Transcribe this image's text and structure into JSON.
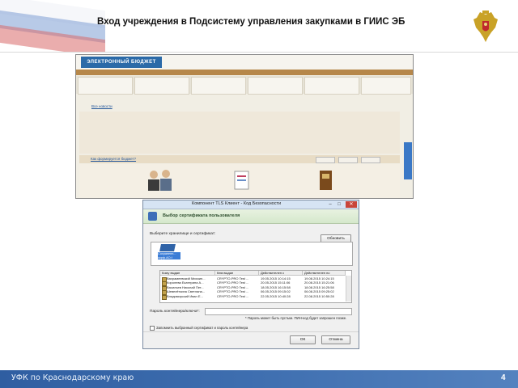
{
  "slide": {
    "title": "Вход учреждения  в Подсистему управления закупками в ГИИС ЭБ",
    "footer_org": "УФК по Краснодарскому краю",
    "page_number": "4"
  },
  "portal_screenshot": {
    "logo_text": "ЭЛЕКТРОННЫЙ БЮДЖЕТ",
    "link_all_news": "Все новости",
    "link_budget_formed": "Как формируется бюджет?"
  },
  "cert_dialog": {
    "window_title": "Компонент TLS Клиент - Код Безопасности",
    "minimize_glyph": "–",
    "maximize_glyph": "□",
    "close_glyph": "✕",
    "heading": "Выбор сертификата пользователя",
    "store_prompt": "Выберите хранилище и сертификат:",
    "refresh_button": "Обновить",
    "store_name": "Сохраненн... окрф.AO.f",
    "columns": [
      "Кому выдан",
      "Кем выдан",
      "Действителен с",
      "Действителен по"
    ],
    "rows": [
      [
        "Вахрамеевский Михаил...",
        "CRYPTO-PRO Test ...",
        "19.05.2015 10:14:15",
        "19.08.2015 10:24:15"
      ],
      [
        "Королева Екатерина А...",
        "CRYPTO-PRO Test ...",
        "20.05.2015 15:11:06",
        "20.08.2015 15:21:06"
      ],
      [
        "Васильев Николай Пет...",
        "CRYPTO-PRO Test ...",
        "18.05.2015 16:15:58",
        "18.08.2015 16:25:58"
      ],
      [
        "Шевелёткина Светлана...",
        "CRYPTO-PRO Test ...",
        "06.05.2015 09:15:02",
        "06.08.2015 09:25:02"
      ],
      [
        "Владимирский Иван Е...",
        "CRYPTO-PRO Test ...",
        "22.05.2015 10:40:28",
        "22.08.2015 10:50:28"
      ]
    ],
    "password_label": "Пароль контейнера/ключа*:",
    "password_note": "* Пароль может быть пустым. ПИН-код будет запрошен позже.",
    "remember_label": "Запомнить выбранный сертификат и пароль контейнера",
    "ok_button": "ОК",
    "cancel_button": "Отмена"
  },
  "colors": {
    "footer_bar": "#3564a7",
    "nav_bar": "#b6874a",
    "dialog_header": "#d5e8cc"
  }
}
